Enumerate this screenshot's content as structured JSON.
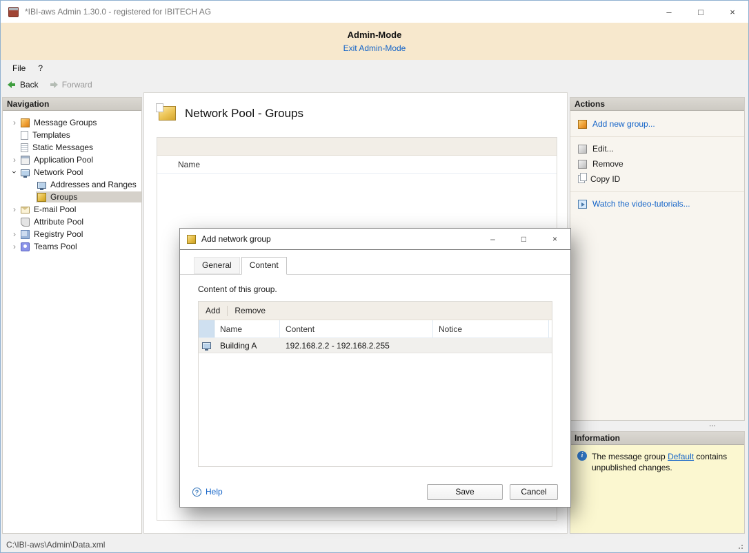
{
  "colors": {
    "link_blue": "#1464c8",
    "admin_banner_bg": "#f7e8cd",
    "info_panel_bg": "#fbf7d0",
    "selection_gray": "#d5d1ca"
  },
  "window": {
    "title": "*IBI-aws Admin 1.30.0 - registered for IBITECH AG",
    "controls": {
      "minimize": "–",
      "maximize": "□",
      "close": "×"
    }
  },
  "admin_banner": {
    "title": "Admin-Mode",
    "exit_link": "Exit Admin-Mode"
  },
  "menu_bar": {
    "items": [
      {
        "label": "File"
      },
      {
        "label": "?"
      }
    ]
  },
  "toolbar": {
    "back_label": "Back",
    "forward_label": "Forward"
  },
  "navigation": {
    "header": "Navigation",
    "items": [
      {
        "label": "Message Groups",
        "icon": "cube-orange",
        "chevron": "right",
        "child": false,
        "selected": false
      },
      {
        "label": "Templates",
        "icon": "doc",
        "chevron": "",
        "child": false,
        "selected": false
      },
      {
        "label": "Static Messages",
        "icon": "doc-lines",
        "chevron": "",
        "child": false,
        "selected": false
      },
      {
        "label": "Application Pool",
        "icon": "window",
        "chevron": "right",
        "child": false,
        "selected": false
      },
      {
        "label": "Network Pool",
        "icon": "monitor",
        "chevron": "down",
        "child": false,
        "selected": false
      },
      {
        "label": "Addresses and Ranges",
        "icon": "monitor",
        "chevron": "",
        "child": true,
        "selected": false
      },
      {
        "label": "Groups",
        "icon": "cube-gold",
        "chevron": "",
        "child": true,
        "selected": true
      },
      {
        "label": "E-mail Pool",
        "icon": "envelope",
        "chevron": "right",
        "child": false,
        "selected": false
      },
      {
        "label": "Attribute Pool",
        "icon": "tag",
        "chevron": "",
        "child": false,
        "selected": false
      },
      {
        "label": "Registry Pool",
        "icon": "registry",
        "chevron": "right",
        "child": false,
        "selected": false
      },
      {
        "label": "Teams Pool",
        "icon": "people",
        "chevron": "right",
        "child": false,
        "selected": false
      }
    ]
  },
  "main": {
    "title": "Network Pool - Groups",
    "hidden_list_header": "Name"
  },
  "dialog": {
    "title": "Add network group",
    "controls": {
      "minimize": "–",
      "maximize": "□",
      "close": "×"
    },
    "tabs": [
      {
        "label": "General",
        "active": false
      },
      {
        "label": "Content",
        "active": true
      }
    ],
    "description": "Content of this group.",
    "list_toolbar": {
      "add_label": "Add",
      "remove_label": "Remove"
    },
    "table": {
      "columns": [
        {
          "label": "Name"
        },
        {
          "label": "Content"
        },
        {
          "label": "Notice"
        }
      ],
      "rows": [
        {
          "icon": "monitor",
          "name": "Building A",
          "content": "192.168.2.2 - 192.168.2.255",
          "notice": ""
        }
      ]
    },
    "help_label": "Help",
    "save_label": "Save",
    "cancel_label": "Cancel"
  },
  "actions": {
    "header": "Actions",
    "items": [
      {
        "label": "Add new group...",
        "icon": "cube-orange",
        "link": true,
        "sep_after": true
      },
      {
        "label": "Edit...",
        "icon": "cube-gray",
        "link": false,
        "sep_after": false
      },
      {
        "label": "Remove",
        "icon": "cube-gray",
        "link": false,
        "sep_after": false
      },
      {
        "label": "Copy ID",
        "icon": "copy",
        "link": false,
        "sep_after": true
      },
      {
        "label": "Watch the video-tutorials...",
        "icon": "video",
        "link": true,
        "sep_after": false
      }
    ]
  },
  "splitter": {
    "grip": "..."
  },
  "information": {
    "header": "Information",
    "text_before": "The message group ",
    "link_text": "Default",
    "text_after": " contains unpublished changes."
  },
  "status_bar": {
    "path": "C:\\IBI-aws\\Admin\\Data.xml"
  }
}
